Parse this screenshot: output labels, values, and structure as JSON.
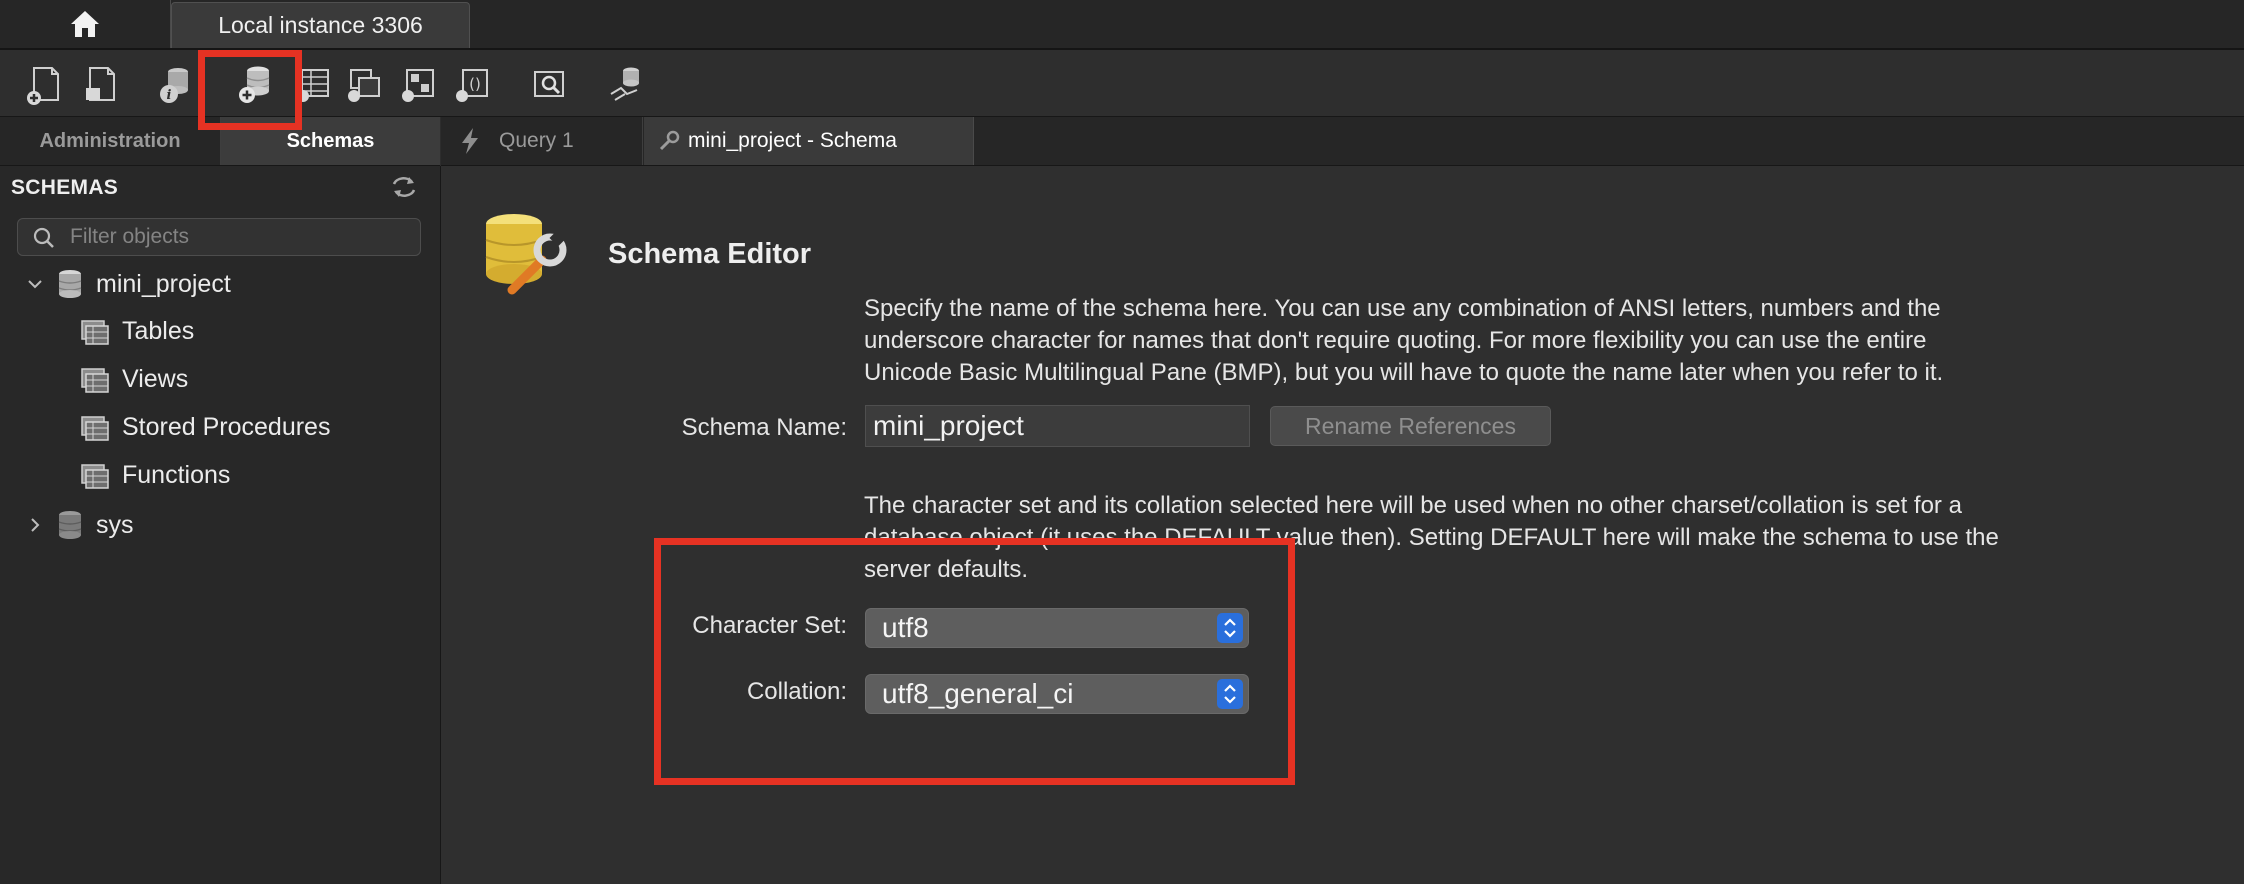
{
  "window": {
    "home_tab": "home",
    "connection_tab": "Local instance 3306"
  },
  "toolbar": {
    "icons": [
      "new-sql-tab-icon",
      "open-sql-script-icon",
      "schema-inspector-icon",
      "create-schema-icon",
      "create-table-icon",
      "create-view-icon",
      "create-procedure-icon",
      "create-function-icon",
      "search-table-data-icon",
      "reconnect-icon"
    ]
  },
  "sidebar": {
    "tabs": {
      "administration": "Administration",
      "schemas": "Schemas"
    },
    "heading": "SCHEMAS",
    "filter_placeholder": "Filter objects",
    "tree": {
      "mini_project": "mini_project",
      "tables": "Tables",
      "views": "Views",
      "stored_procedures": "Stored Procedures",
      "functions": "Functions",
      "sys": "sys"
    }
  },
  "editor_tabs": {
    "query": "Query 1",
    "schema": "mini_project - Schema"
  },
  "editor": {
    "title": "Schema Editor",
    "name_description_lines": [
      "Specify the name of the schema here. You can use any combination of ANSI letters, numbers and the",
      "underscore character for names that don't require quoting. For more flexibility you can use the entire",
      "Unicode Basic Multilingual Pane (BMP), but you will have to quote the name later when you refer to it."
    ],
    "schema_name_label": "Schema Name:",
    "schema_name_value": "mini_project",
    "rename_button": "Rename References",
    "charset_description_lines": [
      "The character set and its collation selected here will be used when no other charset/collation is set for a",
      "database object (it uses the DEFAULT value then). Setting DEFAULT here will make the schema to use the",
      "server defaults."
    ],
    "charset_label": "Character Set:",
    "charset_value": "utf8",
    "collation_label": "Collation:",
    "collation_value": "utf8_general_ci"
  },
  "colors": {
    "annotation_red": "#e63223",
    "stepper_blue": "#2a6fdc",
    "background": "#2d2d2d"
  }
}
